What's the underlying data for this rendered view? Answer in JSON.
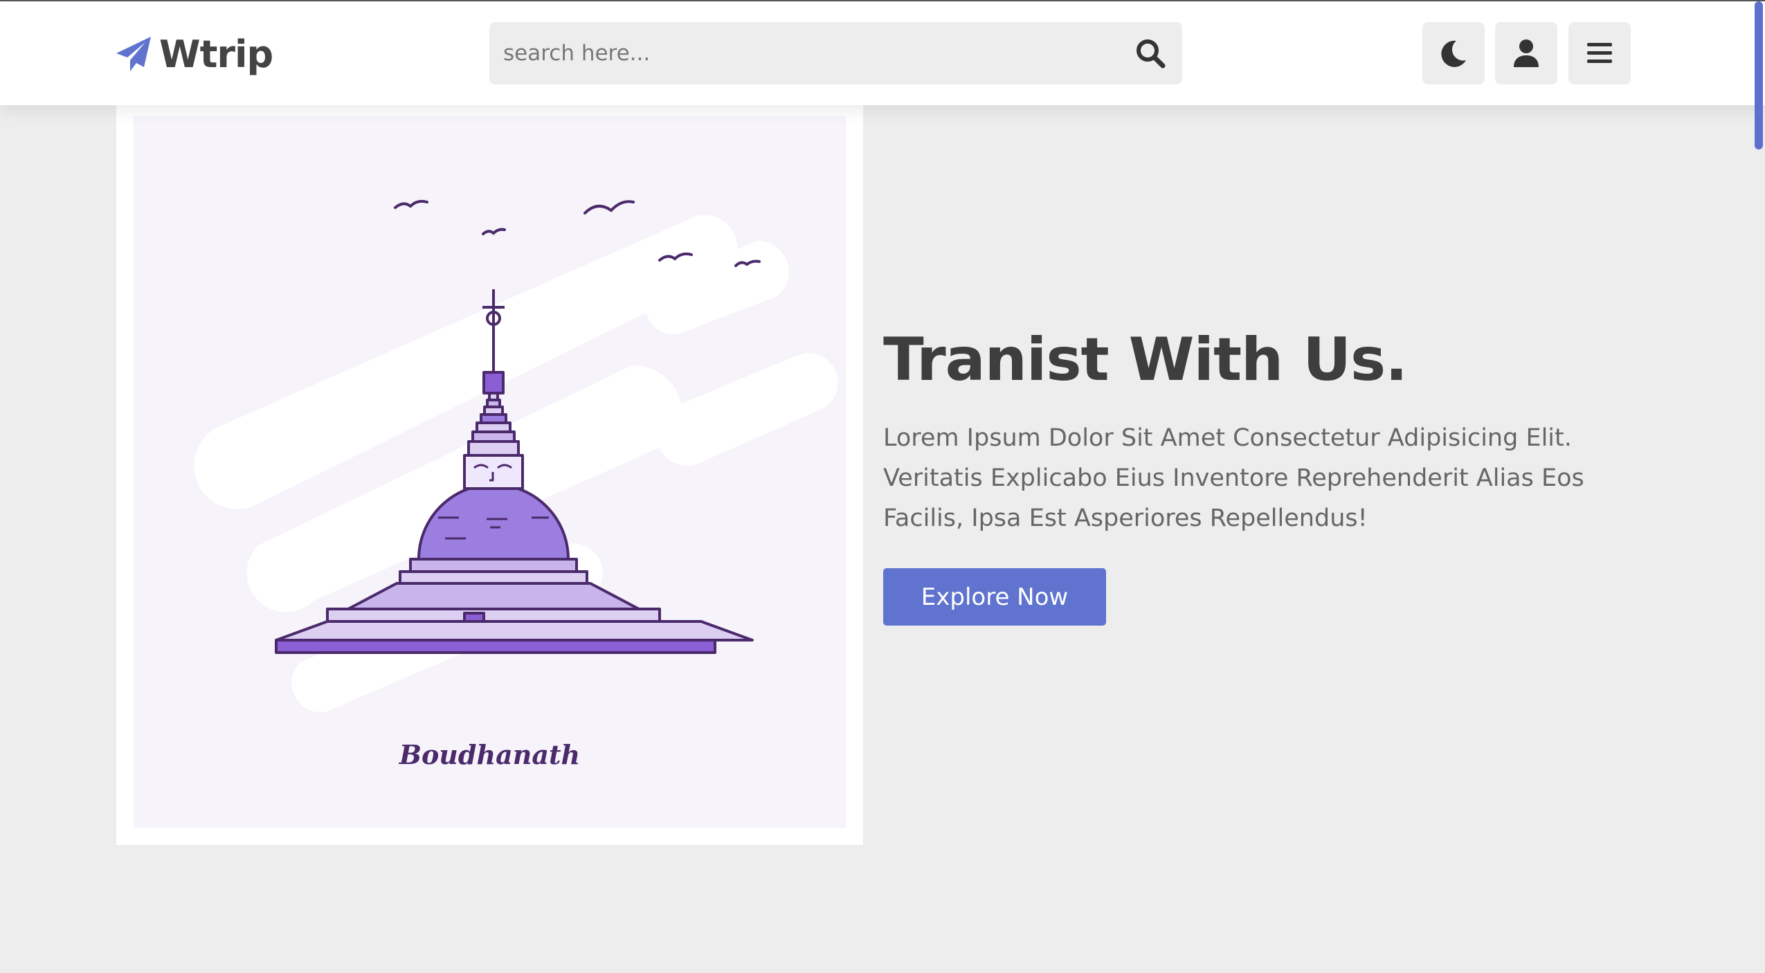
{
  "brand": {
    "name": "Wtrip"
  },
  "search": {
    "placeholder": "search here..."
  },
  "header_icons": [
    "paper-plane-icon",
    "search-icon",
    "moon-icon",
    "user-icon",
    "menu-icon"
  ],
  "hero": {
    "image_caption": "Boudhanath",
    "title": "Tranist With Us.",
    "description": "Lorem Ipsum Dolor Sit Amet Consectetur Adipisicing Elit. Veritatis Explicabo Eius Inventore Reprehenderit Alias Eos Facilis, Ipsa Est Asperiores Repellendus!",
    "cta_label": "Explore Now"
  },
  "colors": {
    "accent": "#5f73cf",
    "background": "#ededed",
    "illustration_purple": "#9b7ee0",
    "illustration_dark": "#4b2a6b"
  }
}
